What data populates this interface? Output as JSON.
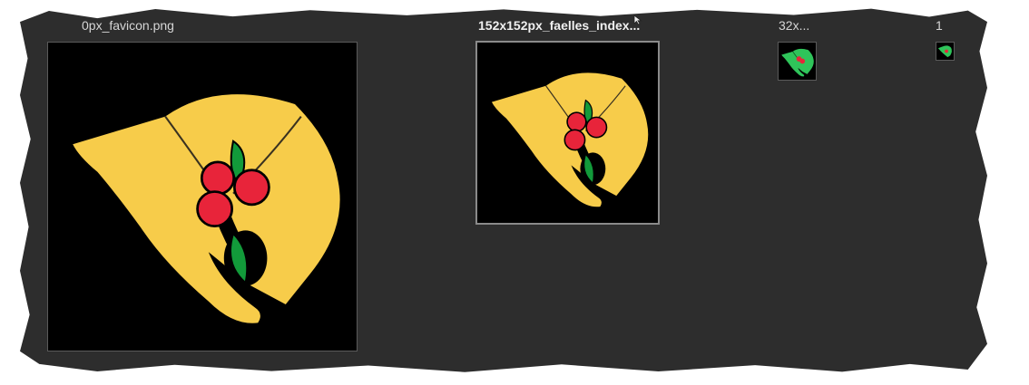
{
  "files": [
    {
      "name": "0px_favicon.png"
    },
    {
      "name": "152x152px_faelles_index..."
    },
    {
      "name": "32x..."
    },
    {
      "name": "1"
    }
  ],
  "colors": {
    "panel": "#2d2d2d",
    "hat": "#f7cc4a",
    "berry": "#e8243a",
    "leaf": "#129a3a",
    "leaf_light": "#2fc45a",
    "thumb_bg": "#000000"
  },
  "icons": [
    "hat-icon",
    "pointer-icon"
  ]
}
